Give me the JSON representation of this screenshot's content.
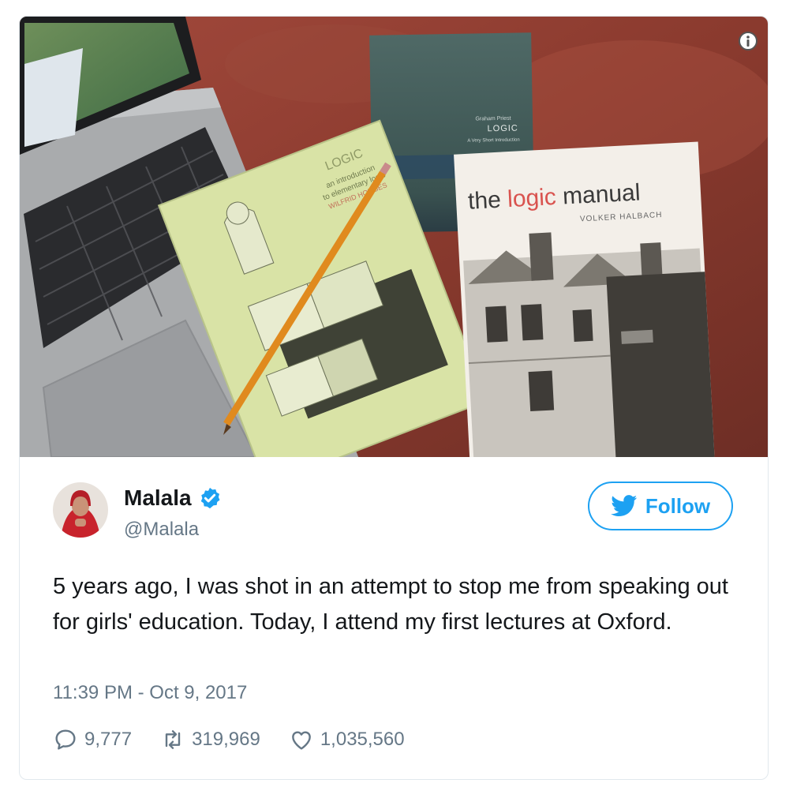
{
  "tweet": {
    "display_name": "Malala",
    "handle": "@Malala",
    "verified": true,
    "follow_label": "Follow",
    "text": "5 years ago, I was shot in an attempt to stop me from speaking out for girls' education. Today, I attend my first lectures at Oxford.",
    "timestamp": "11:39 PM - Oct 9, 2017",
    "stats": {
      "replies": "9,777",
      "retweets": "319,969",
      "likes": "1,035,560"
    }
  },
  "photo": {
    "book_small": {
      "author": "Graham Priest",
      "title": "LOGIC",
      "subtitle": "A Very Short Introduction"
    },
    "book_green": {
      "title": "LOGIC",
      "subtitle_line1": "an introduction",
      "subtitle_line2": "to elementary logic",
      "author": "WILFRID HODGES"
    },
    "book_manual": {
      "title_part1": "the ",
      "title_part2": "logic",
      "title_part3": " manual",
      "author": "VOLKER HALBACH"
    }
  },
  "colors": {
    "accent": "#1da1f2",
    "secondary_text": "#657786",
    "border": "#e1e8ed"
  },
  "icons": {
    "info": "info-icon",
    "verified": "verified-badge-icon",
    "follow": "twitter-bird-icon",
    "reply": "reply-icon",
    "retweet": "retweet-icon",
    "like": "heart-icon"
  }
}
